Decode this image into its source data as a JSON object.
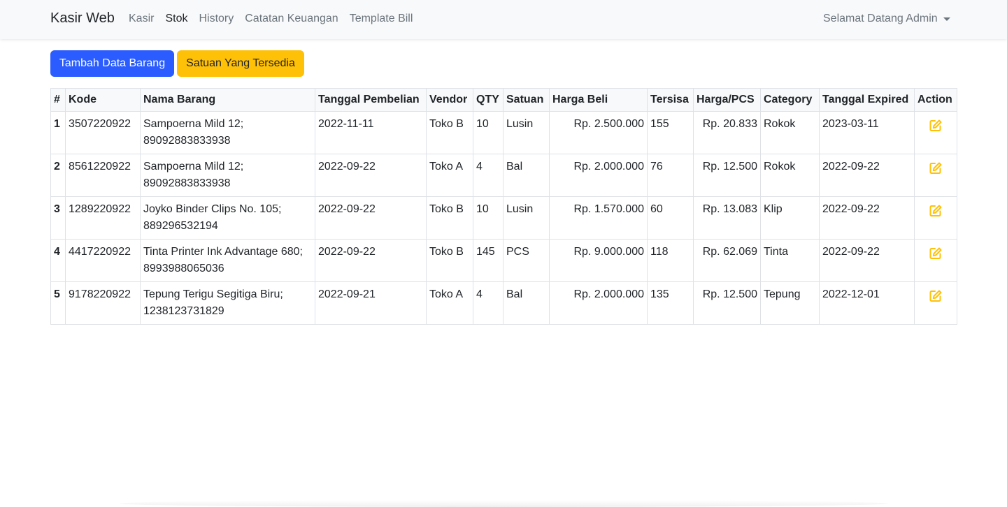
{
  "navbar": {
    "brand": "Kasir Web",
    "links": [
      {
        "label": "Kasir"
      },
      {
        "label": "Stok"
      },
      {
        "label": "History"
      },
      {
        "label": "Catatan Keuangan"
      },
      {
        "label": "Template Bill"
      }
    ],
    "active": "Stok",
    "user_menu": "Selamat Datang Admin"
  },
  "actions": {
    "add_label": "Tambah Data Barang",
    "units_label": "Satuan Yang Tersedia"
  },
  "colors": {
    "primary": "#2b5cff",
    "warning": "#ffc107",
    "edit_icon": "#ffc107"
  },
  "table": {
    "headers": [
      "#",
      "Kode",
      "Nama Barang",
      "Tanggal Pembelian",
      "Vendor",
      "QTY",
      "Satuan",
      "Harga Beli",
      "Tersisa",
      "Harga/PCS",
      "Category",
      "Tanggal Expired",
      "Action"
    ],
    "rows": [
      {
        "no": "1",
        "kode": "3507220922",
        "nama": "Sampoerna Mild 12;",
        "barcode": "89092883833938",
        "tanggal": "2022-11-11",
        "vendor": "Toko B",
        "qty": "10",
        "satuan": "Lusin",
        "harga_beli": "Rp. 2.500.000",
        "tersisa": "155",
        "harga_pcs": "Rp. 20.833",
        "category": "Rokok",
        "expired": "2023-03-11",
        "action_icon": "edit-icon"
      },
      {
        "no": "2",
        "kode": "8561220922",
        "nama": "Sampoerna Mild 12;",
        "barcode": "89092883833938",
        "tanggal": "2022-09-22",
        "vendor": "Toko A",
        "qty": "4",
        "satuan": "Bal",
        "harga_beli": "Rp. 2.000.000",
        "tersisa": "76",
        "harga_pcs": "Rp. 12.500",
        "category": "Rokok",
        "expired": "2022-09-22",
        "action_icon": "edit-icon"
      },
      {
        "no": "3",
        "kode": "1289220922",
        "nama": "Joyko Binder Clips No. 105;",
        "barcode": "889296532194",
        "tanggal": "2022-09-22",
        "vendor": "Toko B",
        "qty": "10",
        "satuan": "Lusin",
        "harga_beli": "Rp. 1.570.000",
        "tersisa": "60",
        "harga_pcs": "Rp. 13.083",
        "category": "Klip",
        "expired": "2022-09-22",
        "action_icon": "edit-icon"
      },
      {
        "no": "4",
        "kode": "4417220922",
        "nama": "Tinta Printer Ink Advantage 680;",
        "barcode": "8993988065036",
        "tanggal": "2022-09-22",
        "vendor": "Toko B",
        "qty": "145",
        "satuan": "PCS",
        "harga_beli": "Rp. 9.000.000",
        "tersisa": "118",
        "harga_pcs": "Rp. 62.069",
        "category": "Tinta",
        "expired": "2022-09-22",
        "action_icon": "edit-icon"
      },
      {
        "no": "5",
        "kode": "9178220922",
        "nama": "Tepung Terigu Segitiga Biru;",
        "barcode": "1238123731829",
        "tanggal": "2022-09-21",
        "vendor": "Toko A",
        "qty": "4",
        "satuan": "Bal",
        "harga_beli": "Rp. 2.000.000",
        "tersisa": "135",
        "harga_pcs": "Rp. 12.500",
        "category": "Tepung",
        "expired": "2022-12-01",
        "action_icon": "edit-icon"
      }
    ]
  }
}
